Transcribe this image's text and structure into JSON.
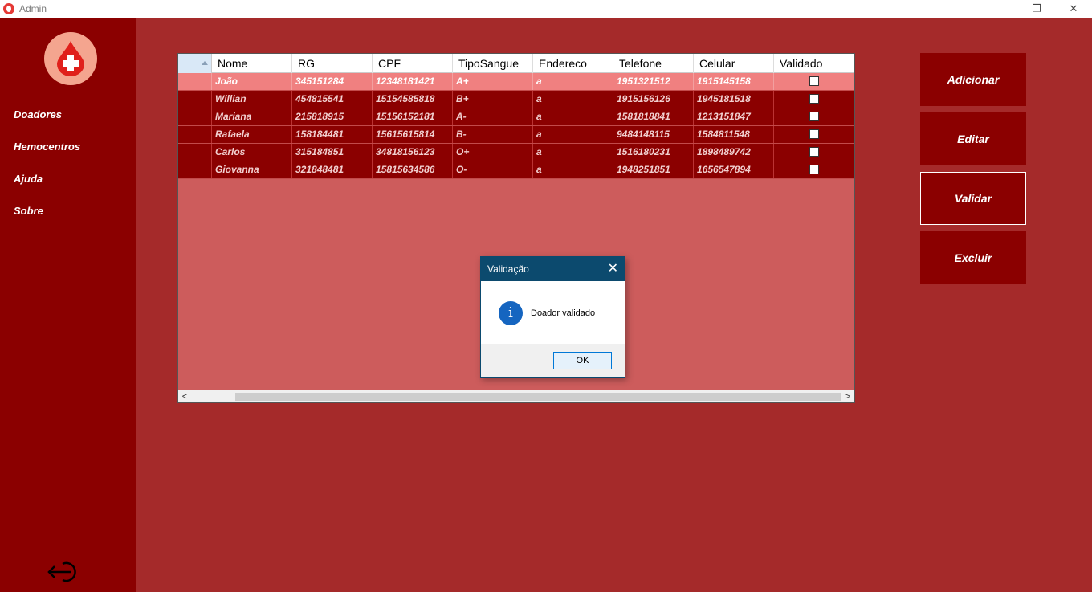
{
  "window": {
    "title": "Admin",
    "minimize": "—",
    "restore": "❐",
    "close": "✕"
  },
  "sidebar": {
    "items": [
      {
        "label": "Doadores"
      },
      {
        "label": "Hemocentros"
      },
      {
        "label": "Ajuda"
      },
      {
        "label": "Sobre"
      }
    ]
  },
  "grid": {
    "columns": [
      "Nome",
      "RG",
      "CPF",
      "TipoSangue",
      "Endereco",
      "Telefone",
      "Celular",
      "Validado"
    ],
    "rows": [
      {
        "nome": "João",
        "rg": "345151284",
        "cpf": "12348181421",
        "tipo": "A+",
        "endereco": "a",
        "telefone": "1951321512",
        "celular": "1915145158",
        "validado": false
      },
      {
        "nome": "Willian",
        "rg": "454815541",
        "cpf": "15154585818",
        "tipo": "B+",
        "endereco": "a",
        "telefone": "1915156126",
        "celular": "1945181518",
        "validado": false
      },
      {
        "nome": "Mariana",
        "rg": "215818915",
        "cpf": "15156152181",
        "tipo": "A-",
        "endereco": "a",
        "telefone": "1581818841",
        "celular": "1213151847",
        "validado": false
      },
      {
        "nome": "Rafaela",
        "rg": "158184481",
        "cpf": "15615615814",
        "tipo": "B-",
        "endereco": "a",
        "telefone": "9484148115",
        "celular": "1584811548",
        "validado": false
      },
      {
        "nome": "Carlos",
        "rg": "315184851",
        "cpf": "34818156123",
        "tipo": "O+",
        "endereco": "a",
        "telefone": "1516180231",
        "celular": "1898489742",
        "validado": false
      },
      {
        "nome": "Giovanna",
        "rg": "321848481",
        "cpf": "15815634586",
        "tipo": "O-",
        "endereco": "a",
        "telefone": "1948251851",
        "celular": "1656547894",
        "validado": false
      }
    ],
    "selected_row": 0,
    "scroll_left": "<",
    "scroll_right": ">"
  },
  "actions": {
    "add": "Adicionar",
    "edit": "Editar",
    "validate": "Validar",
    "delete": "Excluir"
  },
  "dialog": {
    "title": "Validação",
    "message": "Doador validado",
    "ok": "OK",
    "close": "✕",
    "icon": "i"
  },
  "colors": {
    "sidebar": "#8b0000",
    "background": "#a52a2a",
    "grid_body": "#cd5c5c",
    "row": "#8b0000",
    "row_selected": "#f08080",
    "dialog_title": "#0c4a6e"
  }
}
